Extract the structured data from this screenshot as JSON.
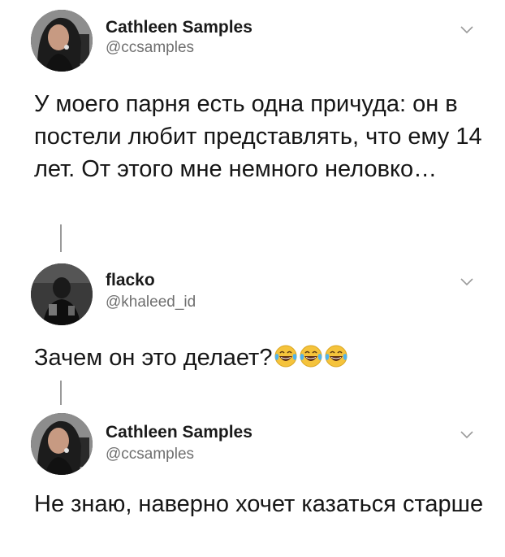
{
  "tweets": [
    {
      "author_name": "Cathleen Samples",
      "author_handle": "@ccsamples",
      "text": "У моего парня есть одна причуда: он в постели любит представлять, что ему 14 лет. От этого мне немного неловко…",
      "menu_icon": "chevron-down-icon"
    },
    {
      "author_name": "flacko",
      "author_handle": "@khaleed_id",
      "text": "Зачем он это делает?",
      "trailing_emoji": [
        "face-with-tears-of-joy",
        "face-with-tears-of-joy",
        "face-with-tears-of-joy"
      ],
      "menu_icon": "chevron-down-icon"
    },
    {
      "author_name": "Cathleen Samples",
      "author_handle": "@ccsamples",
      "text": "Не знаю, наверно хочет казаться старше",
      "menu_icon": "chevron-down-icon"
    }
  ],
  "colors": {
    "background": "#ffffff",
    "text": "#161616",
    "handle": "#6f6f6f",
    "thread_line": "#9a9a9a",
    "emoji_face": "#f5c33b",
    "emoji_tears": "#4fb3ee"
  }
}
